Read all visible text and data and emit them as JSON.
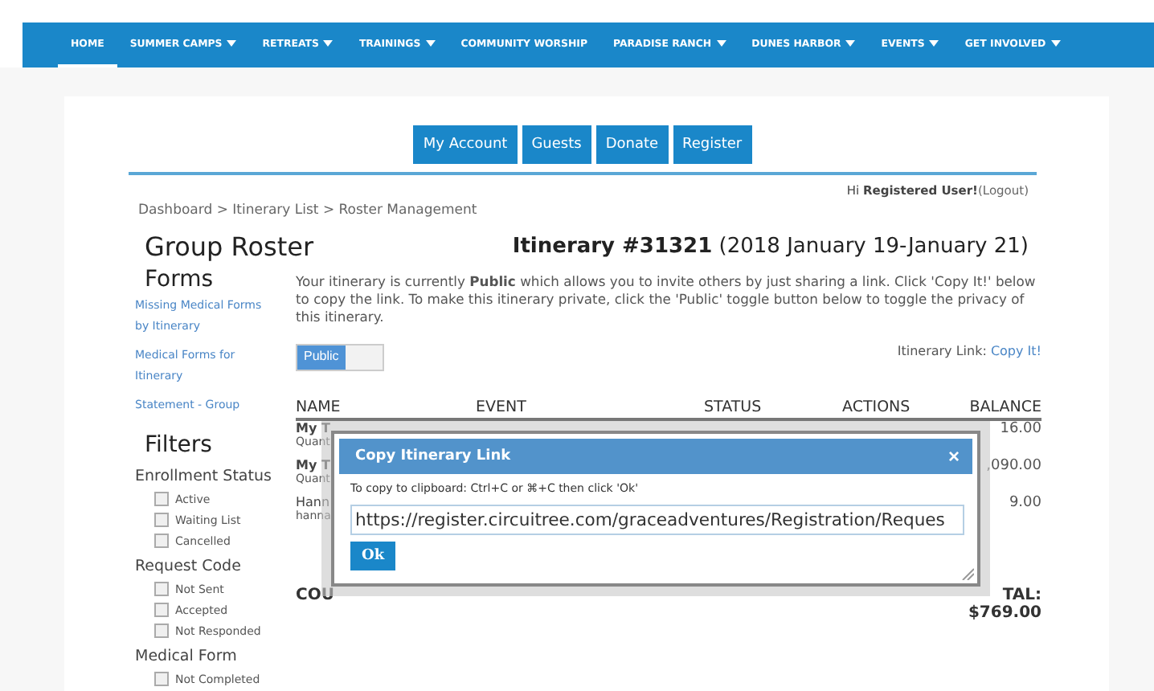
{
  "nav": [
    {
      "label": "HOME",
      "selected": true,
      "dropdown": false
    },
    {
      "label": "SUMMER CAMPS",
      "selected": false,
      "dropdown": true
    },
    {
      "label": "RETREATS",
      "selected": false,
      "dropdown": true
    },
    {
      "label": "TRAININGS",
      "selected": false,
      "dropdown": true
    },
    {
      "label": "COMMUNITY WORSHIP",
      "selected": false,
      "dropdown": false
    },
    {
      "label": "PARADISE RANCH",
      "selected": false,
      "dropdown": true
    },
    {
      "label": "DUNES HARBOR",
      "selected": false,
      "dropdown": true
    },
    {
      "label": "EVENTS",
      "selected": false,
      "dropdown": true
    },
    {
      "label": "GET INVOLVED",
      "selected": false,
      "dropdown": true
    }
  ],
  "account_buttons": [
    "My Account",
    "Guests",
    "Donate",
    "Register"
  ],
  "greeting": {
    "hi": "Hi",
    "user": "Registered User!",
    "logout": "(Logout)"
  },
  "breadcrumb": "Dashboard > Itinerary List > Roster Management",
  "title": "Group Roster",
  "itinerary_heading": {
    "number": "Itinerary #31321",
    "dates": "(2018 January 19-January 21)"
  },
  "sidebar": {
    "forms_heading": "Forms",
    "links": [
      "Missing Medical Forms by Itinerary",
      "Medical Forms for Itinerary",
      "Statement - Group"
    ],
    "filters_heading": "Filters",
    "filter_groups": [
      {
        "title": "Enrollment Status",
        "options": [
          {
            "label": "Active",
            "checked": false
          },
          {
            "label": "Waiting List",
            "checked": false
          },
          {
            "label": "Cancelled",
            "checked": false
          }
        ]
      },
      {
        "title": "Request Code",
        "options": [
          {
            "label": "Not Sent",
            "checked": false
          },
          {
            "label": "Accepted",
            "checked": false
          },
          {
            "label": "Not Responded",
            "checked": false
          }
        ]
      },
      {
        "title": "Medical Form",
        "options": [
          {
            "label": "Not Completed",
            "checked": false
          }
        ]
      }
    ]
  },
  "notice": "Your itinerary is currently **Public** which allows you to invite others by just sharing a link. Click 'Copy It!' below to copy the link. To make this itinerary private, click the 'Public' toggle button below to toggle the privacy of this itinerary.",
  "privacy_toggle": {
    "label": "Public",
    "on": true
  },
  "itinerary_link": {
    "label": "Itinerary Link:",
    "link": "Copy It!"
  },
  "table": {
    "columns": [
      "NAME",
      "EVENT",
      "STATUS",
      "ACTIONS",
      "BALANCE"
    ],
    "rows": [
      {
        "name": "My T",
        "sub": "Quant",
        "balance": "16.00"
      },
      {
        "name": "My T",
        "sub": "Quant",
        "balance": ",090.00"
      },
      {
        "name": "Hann",
        "sub": "hanna",
        "balance": "9.00"
      }
    ],
    "footer": {
      "label": "COU",
      "total_label": "TAL:",
      "total": "$769.00"
    }
  },
  "dialog": {
    "title": "Copy Itinerary Link",
    "close": "×",
    "instruction": "To copy to clipboard: Ctrl+C or ⌘+C then click 'Ok'",
    "url": "https://register.circuitree.com/graceadventures/Registration/Reques",
    "ok": "Ok"
  }
}
